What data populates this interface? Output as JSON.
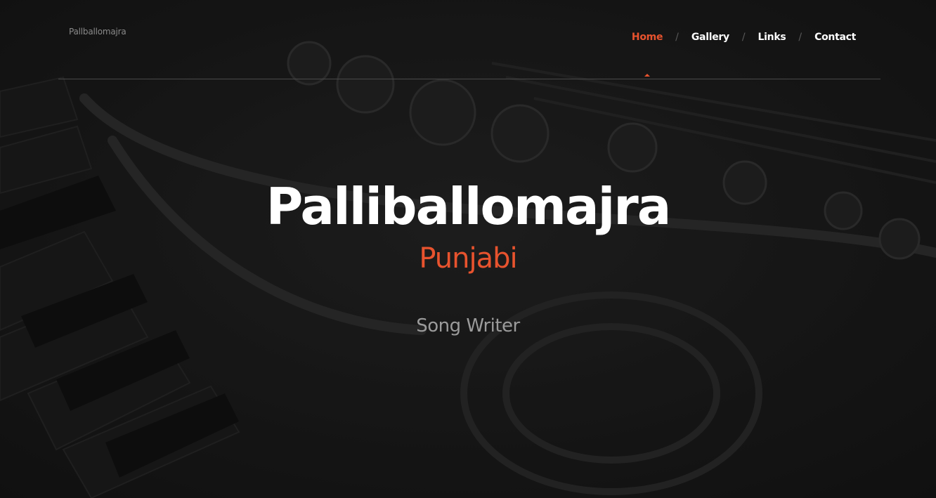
{
  "header": {
    "brand": "Pallballomajra",
    "nav": [
      {
        "label": "Home",
        "active": true
      },
      {
        "label": "Gallery",
        "active": false
      },
      {
        "label": "Links",
        "active": false
      },
      {
        "label": "Contact",
        "active": false
      }
    ],
    "separator": "/"
  },
  "hero": {
    "title": "Palliballomajra",
    "subtitle": "Punjabi",
    "role": "Song Writer"
  },
  "colors": {
    "accent": "#e8532e",
    "background": "#161616",
    "text": "#ffffff",
    "muted": "#9b9b9b"
  },
  "background_image": "saxophone-on-piano-keys-dark-photo"
}
